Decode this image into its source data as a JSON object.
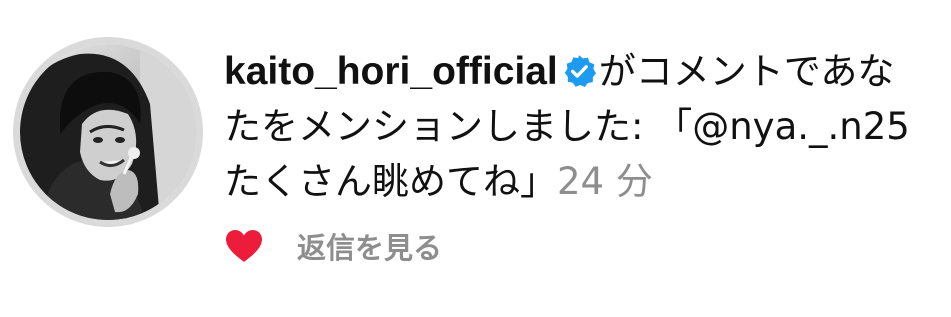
{
  "notification": {
    "username": "kaito_hori_official",
    "verified_icon": "verified-badge-icon",
    "verified_color": "#1d9bf0",
    "message_line1": "がコメントであな",
    "message_line2": "たをメンションしました: 「@nya._.n25",
    "message_line3": "たくさん眺めてね」",
    "timestamp": "24 分",
    "like_icon": "heart-icon",
    "like_color": "#ed1c3a",
    "view_replies_label": "返信を見る"
  }
}
